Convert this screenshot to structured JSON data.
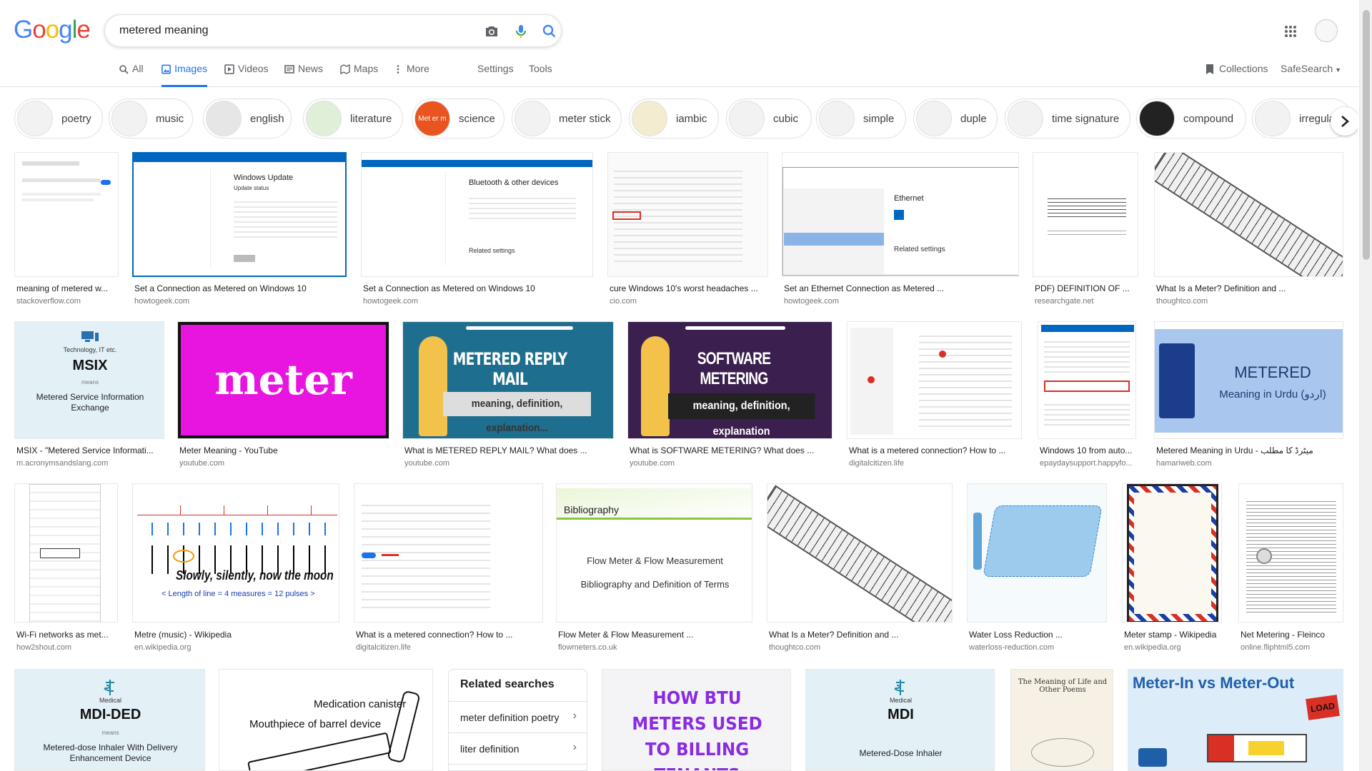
{
  "header": {
    "logo": [
      "G",
      "o",
      "o",
      "g",
      "l",
      "e"
    ],
    "search_value": "metered meaning",
    "tabs": {
      "all": "All",
      "images": "Images",
      "videos": "Videos",
      "news": "News",
      "maps": "Maps",
      "more": "More",
      "settings": "Settings",
      "tools": "Tools"
    },
    "collections": "Collections",
    "safesearch": "SafeSearch"
  },
  "chips": [
    "poetry",
    "music",
    "english",
    "literature",
    "science",
    "meter stick",
    "iambic",
    "cubic",
    "simple",
    "duple",
    "time signature",
    "compound",
    "irregula"
  ],
  "chip_science_thumb": "Met er m",
  "results_row1": [
    {
      "title": "meaning of metered w...",
      "source": "stackoverflow.com"
    },
    {
      "title": "Set a Connection as Metered on Windows 10",
      "source": "howtogeek.com"
    },
    {
      "title": "Set a Connection as Metered on Windows 10",
      "source": "howtogeek.com"
    },
    {
      "title": "cure Windows 10's worst headaches ...",
      "source": "cio.com"
    },
    {
      "title": "Set an Ethernet Connection as Metered ...",
      "source": "howtogeek.com"
    },
    {
      "title": "PDF) DEFINITION OF ...",
      "source": "researchgate.net"
    },
    {
      "title": "What Is a Meter? Definition and ...",
      "source": "thoughtco.com"
    }
  ],
  "results_row2": [
    {
      "title": "MSIX - \"Metered Service Informati...",
      "source": "m.acronymsandslang.com"
    },
    {
      "title": "Meter Meaning - YouTube",
      "source": "youtube.com"
    },
    {
      "title": "What is METERED REPLY MAIL? What does ...",
      "source": "youtube.com"
    },
    {
      "title": "What is SOFTWARE METERING? What does ...",
      "source": "youtube.com"
    },
    {
      "title": "What is a metered connection? How to ...",
      "source": "digitalcitizen.life"
    },
    {
      "title": "Windows 10 from auto...",
      "source": "epaydaysupport.happyfo..."
    },
    {
      "title": "Metered Meaning in Urdu - میٹرڈ کا مطلب",
      "source": "hamariweb.com"
    }
  ],
  "results_row3": [
    {
      "title": "Wi-Fi networks as met...",
      "source": "how2shout.com"
    },
    {
      "title": "Metre (music) - Wikipedia",
      "source": "en.wikipedia.org"
    },
    {
      "title": "What is a metered connection? How to ...",
      "source": "digitalcitizen.life"
    },
    {
      "title": "Flow Meter & Flow Measurement ...",
      "source": "flowmeters.co.uk"
    },
    {
      "title": "What Is a Meter? Definition and ...",
      "source": "thoughtco.com"
    },
    {
      "title": "Water Loss Reduction ...",
      "source": "waterloss-reduction.com"
    },
    {
      "title": "Meter stamp - Wikipedia",
      "source": "en.wikipedia.org"
    },
    {
      "title": "Net Metering - Fleinco",
      "source": "online.fliphtml5.com"
    }
  ],
  "thumb_text": {
    "win_update_title": "Windows Update",
    "win_update_status": "Update status",
    "bluetooth_title": "Bluetooth & other devices",
    "bluetooth_related": "Related settings",
    "ethernet_title": "Ethernet",
    "ethernet_related": "Related settings",
    "msix_top": "Technology, IT etc.",
    "msix_abbr": "MSIX",
    "msix_means": "means",
    "msix_full": "Metered Service Information Exchange",
    "meter_word": "meter",
    "reply_mail": "METERED REPLY MAIL",
    "reply_sub": "meaning, definition, explanation...",
    "software_metering": "SOFTWARE METERING",
    "software_sub": "meaning, definition, explanation",
    "urdu_title": "METERED",
    "urdu_sub": "Meaning in Urdu (اردو)",
    "flow_title": "Bibliography",
    "flow_line1": "Flow Meter & Flow Measurement",
    "flow_line2": "Bibliography and Definition of Terms",
    "music_caption": "< Length of line = 4 measures = 12 pulses >",
    "music_lyric": "Slowly, silently, now the moon"
  },
  "row4": {
    "mdided_top": "Medical",
    "mdided_abbr": "MDI-DED",
    "mdided_means": "means",
    "mdided_full": "Metered-dose Inhaler With Delivery Enhancement Device",
    "inhaler_l1": "Medication canister",
    "inhaler_l2": "Mouthpiece of barrel device",
    "btu": "HOW BTU METERS USED TO BILLING TENANTS",
    "mdi_top": "Medical",
    "mdi_abbr": "MDI",
    "mdi_full": "Metered-Dose Inhaler",
    "book_title": "The Meaning of Life and Other Poems",
    "meter_in_out": "Meter-In vs Meter-Out",
    "load": "LOAD"
  },
  "related": {
    "heading": "Related searches",
    "items": [
      "meter definition poetry",
      "liter definition"
    ]
  },
  "colors": {
    "accent": "#1a73e8",
    "magenta": "#e815e0",
    "teal": "#1e6f8f"
  }
}
